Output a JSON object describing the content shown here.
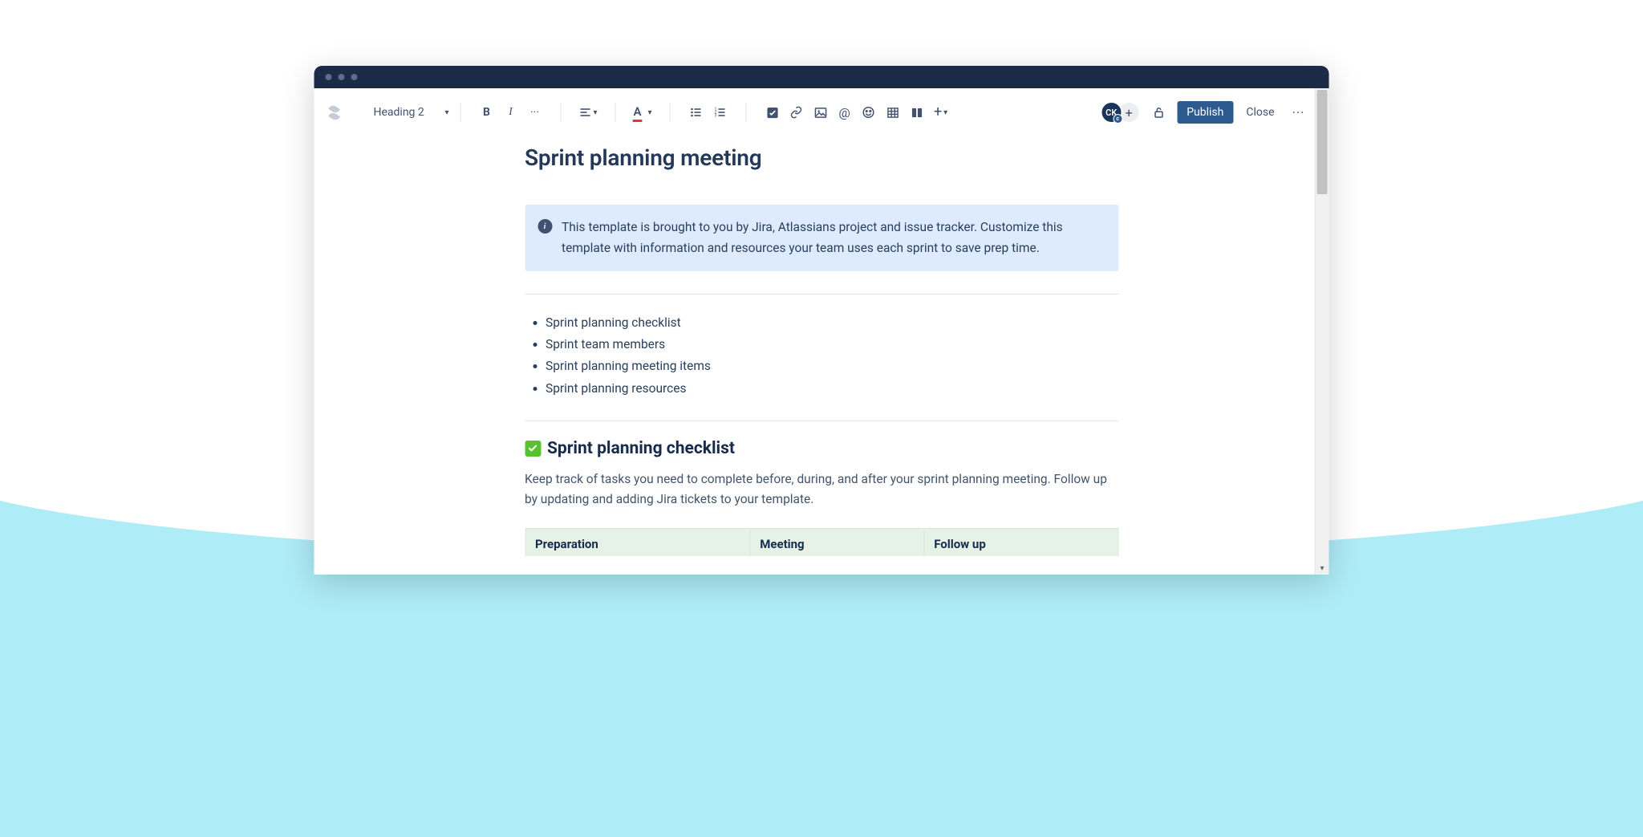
{
  "toolbar": {
    "heading_label": "Heading 2",
    "avatar_initials": "CK",
    "publish_label": "Publish",
    "close_label": "Close"
  },
  "page": {
    "title": "Sprint planning meeting"
  },
  "info_panel": {
    "text": "This template is brought to you by Jira, Atlassians project and issue tracker. Customize this template with information and resources your team uses each sprint to save prep time."
  },
  "toc": [
    "Sprint planning checklist",
    "Sprint team members",
    "Sprint planning meeting items",
    "Sprint planning resources"
  ],
  "section_checklist": {
    "heading": "Sprint planning checklist",
    "description": "Keep track of tasks you need to complete before, during, and after your sprint planning meeting. Follow up by updating and adding Jira tickets to your template.",
    "columns": [
      "Preparation",
      "Meeting",
      "Follow up"
    ]
  }
}
